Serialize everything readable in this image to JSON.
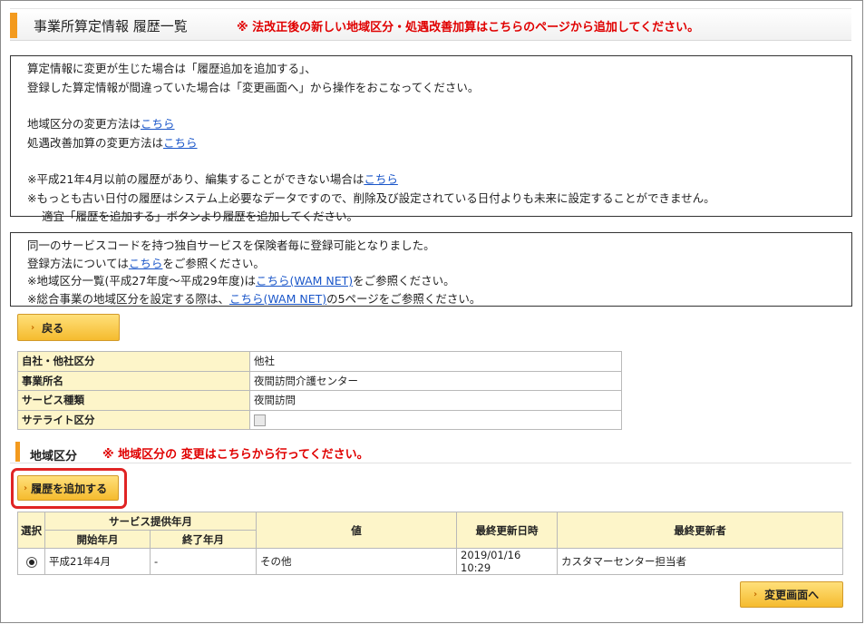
{
  "header": {
    "title": "事業所算定情報 履歴一覧",
    "warning": "※ 法改正後の新しい地域区分・処遇改善加算はこちらのページから追加してください。"
  },
  "notice1": {
    "line1": "算定情報に変更が生じた場合は「履歴追加を追加する」、",
    "line2": "登録した算定情報が間違っていた場合は「変更画面へ」から操作をおこなってください。",
    "area_text": "地域区分の変更方法は",
    "area_link": "こちら",
    "treatment_text": "処遇改善加算の変更方法は",
    "treatment_link": "こちら",
    "h21_text": "※平成21年4月以前の履歴があり、編集することができない場合は",
    "h21_link": "こちら",
    "oldest_text": "※もっとも古い日付の履歴はシステム上必要なデータですので、削除及び設定されている日付よりも未来に設定することができません。",
    "oldest_text2": "適宜「履歴を追加する」ボタンより履歴を追加してください。"
  },
  "notice2": {
    "line1": "同一のサービスコードを持つ独自サービスを保険者毎に登録可能となりました。",
    "reg_text": "登録方法については",
    "reg_link": "こちら",
    "reg_suffix": "をご参照ください。",
    "area_list_text": "※地域区分一覧(平成27年度～平成29年度)は",
    "area_list_link": "こちら(WAM NET)",
    "area_list_suffix": "をご参照ください。",
    "sogo_text": "※総合事業の地域区分を設定する際は、",
    "sogo_link": "こちら(WAM NET)",
    "sogo_suffix": "の5ページをご参照ください。"
  },
  "buttons": {
    "back": "戻る",
    "add_history": "履歴を追加する",
    "change": "変更画面へ"
  },
  "info": {
    "rows": [
      {
        "label": "自社・他社区分",
        "value": "他社"
      },
      {
        "label": "事業所名",
        "value": "夜間訪問介護センター"
      },
      {
        "label": "サービス種類",
        "value": "夜間訪問"
      },
      {
        "label": "サテライト区分",
        "value": ""
      }
    ]
  },
  "section": {
    "title": "地域区分",
    "warning": "※ 地域区分の 変更はこちらから行ってください。"
  },
  "history": {
    "headers": {
      "select": "選択",
      "period": "サービス提供年月",
      "start": "開始年月",
      "end": "終了年月",
      "value": "値",
      "updated_at": "最終更新日時",
      "updated_by": "最終更新者"
    },
    "rows": [
      {
        "start": "平成21年4月",
        "end": "-",
        "value": "その他",
        "updated_at": "2019/01/16 10:29",
        "updated_by": "カスタマーセンター担当者"
      }
    ]
  }
}
